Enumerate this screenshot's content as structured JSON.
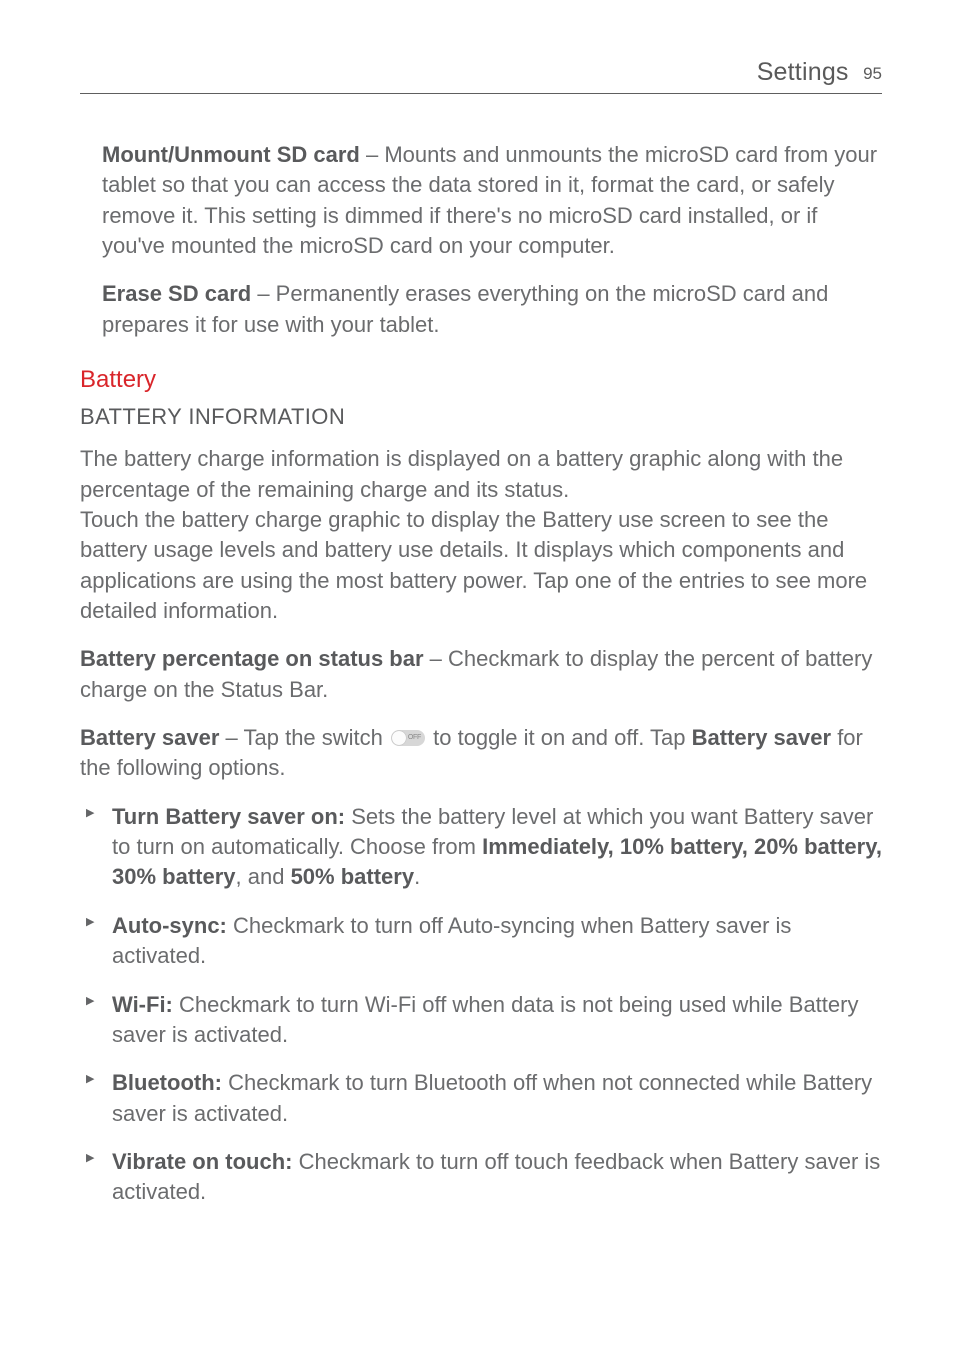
{
  "header": {
    "title": "Settings",
    "page_number": "95"
  },
  "entries": {
    "mount_bold": "Mount/Unmount SD card",
    "mount_text": " – Mounts and unmounts the microSD card from your tablet so that you can access the data stored in it, format the card, or safely remove it. This setting is dimmed if there's no microSD card installed, or if you've mounted the microSD card on your computer.",
    "erase_bold": "Erase SD card",
    "erase_text": " – Permanently erases everything on the microSD card and prepares it for use with your tablet."
  },
  "battery": {
    "heading": "Battery",
    "subheading": "BATTERY INFORMATION",
    "intro_p1": "The battery charge information is displayed on a battery graphic along with the percentage of the remaining charge and its status.",
    "intro_p2": "Touch the battery charge graphic to display the Battery use screen to see the battery usage levels and battery use details. It displays which components and applications are using the most battery power. Tap one of the entries to see more detailed information.",
    "percent_bold": "Battery percentage on status bar",
    "percent_text": " – Checkmark to display the percent of battery charge on the Status Bar.",
    "saver_bold1": "Battery saver",
    "saver_text1": " – Tap the switch ",
    "saver_text2": " to toggle it on and off. Tap ",
    "saver_bold2": "Battery saver",
    "saver_text3": " for the following options."
  },
  "bullets": [
    {
      "bold1": "Turn Battery saver on:",
      "t1": " Sets the battery level at which you want Battery saver to turn on automatically. Choose from ",
      "bold2": "Immediately, 10% battery, 20% battery, 30% battery",
      "t2": ", and ",
      "bold3": "50% battery",
      "t3": "."
    },
    {
      "bold1": "Auto-sync:",
      "t1": " Checkmark to turn off Auto-syncing when Battery saver is activated.",
      "bold2": "",
      "t2": "",
      "bold3": "",
      "t3": ""
    },
    {
      "bold1": "Wi-Fi:",
      "t1": " Checkmark to turn Wi-Fi off when data is not being used while Battery saver is activated.",
      "bold2": "",
      "t2": "",
      "bold3": "",
      "t3": ""
    },
    {
      "bold1": "Bluetooth:",
      "t1": " Checkmark to turn Bluetooth off when not connected while Battery saver is activated.",
      "bold2": "",
      "t2": "",
      "bold3": "",
      "t3": ""
    },
    {
      "bold1": "Vibrate on touch:",
      "t1": " Checkmark to turn off touch feedback when Battery saver is activated.",
      "bold2": "",
      "t2": "",
      "bold3": "",
      "t3": ""
    }
  ]
}
